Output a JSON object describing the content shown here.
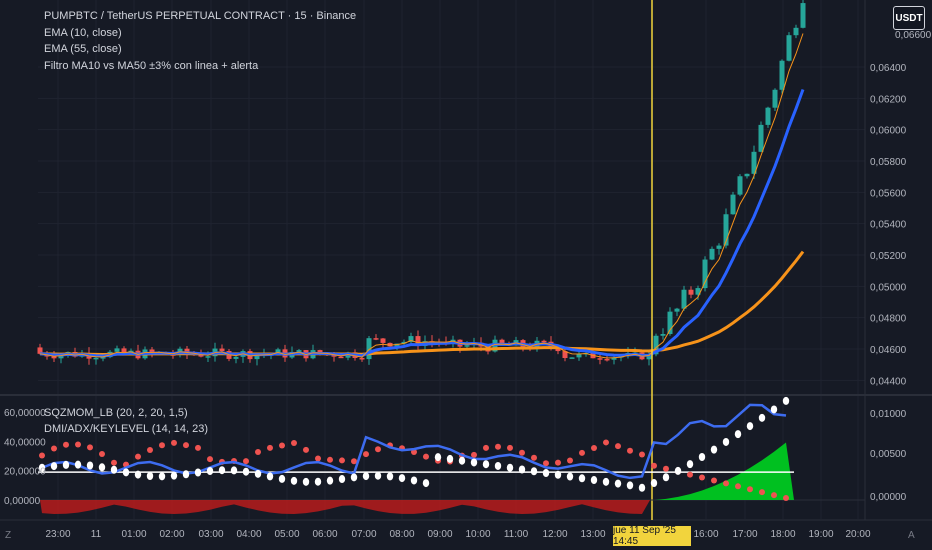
{
  "legend": {
    "symbol": "PUMPBTC / TetherUS PERPETUAL CONTRACT · 15 · Binance",
    "ema_fast": "EMA (10, close)",
    "ema_slow": "EMA (55, close)",
    "filter": "Filtro MA10 vs MA50 ±3% con linea + alerta"
  },
  "lower_legend": {
    "sqzmom": "SQZMOM_LB (20, 2, 20, 1,5)",
    "dmi": "DMI/ADX/KEYLEVEL (14, 14, 23)"
  },
  "currency_button": "USDT",
  "price_axis": [
    "0,06400",
    "0,06200",
    "0,06000",
    "0,05800",
    "0,05600",
    "0,05400",
    "0,05200",
    "0,05000",
    "0,04800",
    "0,04600",
    "0,04400"
  ],
  "price_axis_top_partial": "0,06600",
  "lower_left_axis": [
    "60,00000",
    "40,00000",
    "20,00000",
    "0,00000"
  ],
  "lower_right_axis": [
    "0,01000",
    "0,00500",
    "0,00000"
  ],
  "time_axis": [
    "23:00",
    "11",
    "01:00",
    "02:00",
    "03:00",
    "04:00",
    "05:00",
    "06:00",
    "07:00",
    "08:00",
    "09:00",
    "10:00",
    "11:00",
    "12:00",
    "13:00",
    "16:00",
    "17:00",
    "18:00",
    "19:00",
    "20:00"
  ],
  "crosshair_time": "jue 11 Sep '25   14:45",
  "corner_left": "Z",
  "corner_right": "A",
  "colors": {
    "background": "#161a25",
    "up": "#26a69a",
    "down": "#ef5350",
    "ema_fast": "#2962ff",
    "ema_slow": "#f7931a",
    "crosshair": "#f2d43d",
    "adx": "#ffffff",
    "green_area": "#00c020",
    "red_area": "#b71c1c"
  }
}
